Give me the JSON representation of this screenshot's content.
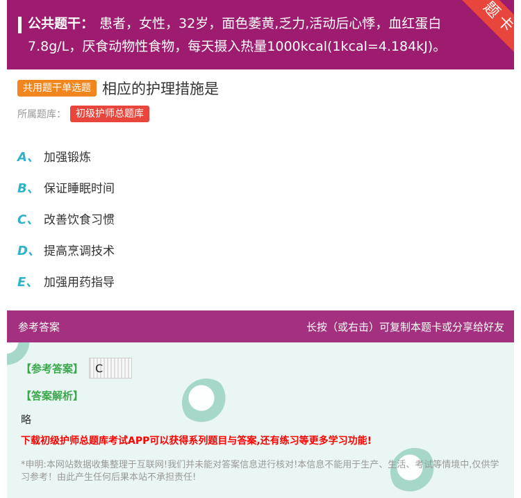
{
  "stem": {
    "label": "公共题干：",
    "text": "患者，女性，32岁，面色萎黄,乏力,活动后心悸，血红蛋白7.8g/L，厌食动物性食物，每天摄入热量1000kcal(1kcal=4.184kJ)。",
    "ribbon": "题卡"
  },
  "question": {
    "tag": "共用题干单选题",
    "text": "相应的护理措施是",
    "bank_label": "所属题库：",
    "bank": "初级护师总题库"
  },
  "options": [
    {
      "letter": "A、",
      "text": "加强锻炼"
    },
    {
      "letter": "B、",
      "text": "保证睡眠时间"
    },
    {
      "letter": "C、",
      "text": "改善饮食习惯"
    },
    {
      "letter": "D、",
      "text": "提高烹调技术"
    },
    {
      "letter": "E、",
      "text": "加强用药指导"
    }
  ],
  "answer": {
    "header_left": "参考答案",
    "header_right": "长按（或右击）可复制本题卡或分享给好友",
    "key_label": "【参考答案】",
    "key_value": "C",
    "analysis_label": "【答案解析】",
    "analysis_text": "略",
    "promo": "下载初级护师总题库考试APP可以获得系列题目与答案,还有练习等更多学习功能!",
    "disclaimer": "*申明:本网站数据收集整理于互联网!我们并未能对答案信息进行核对!本信息不能用于生产、生活、考试等情境中,仅供学习参考！由此产生任何后果本站不承担责任!"
  },
  "colors": {
    "stem_bg": "#9d1c70",
    "answer_header_bg": "#a3317f",
    "ribbon": "#e8463c",
    "tag_orange": "#f2861e",
    "option_letter": "#2fb3c9",
    "answer_green": "#3aa84a",
    "promo_red": "#ff0000"
  }
}
